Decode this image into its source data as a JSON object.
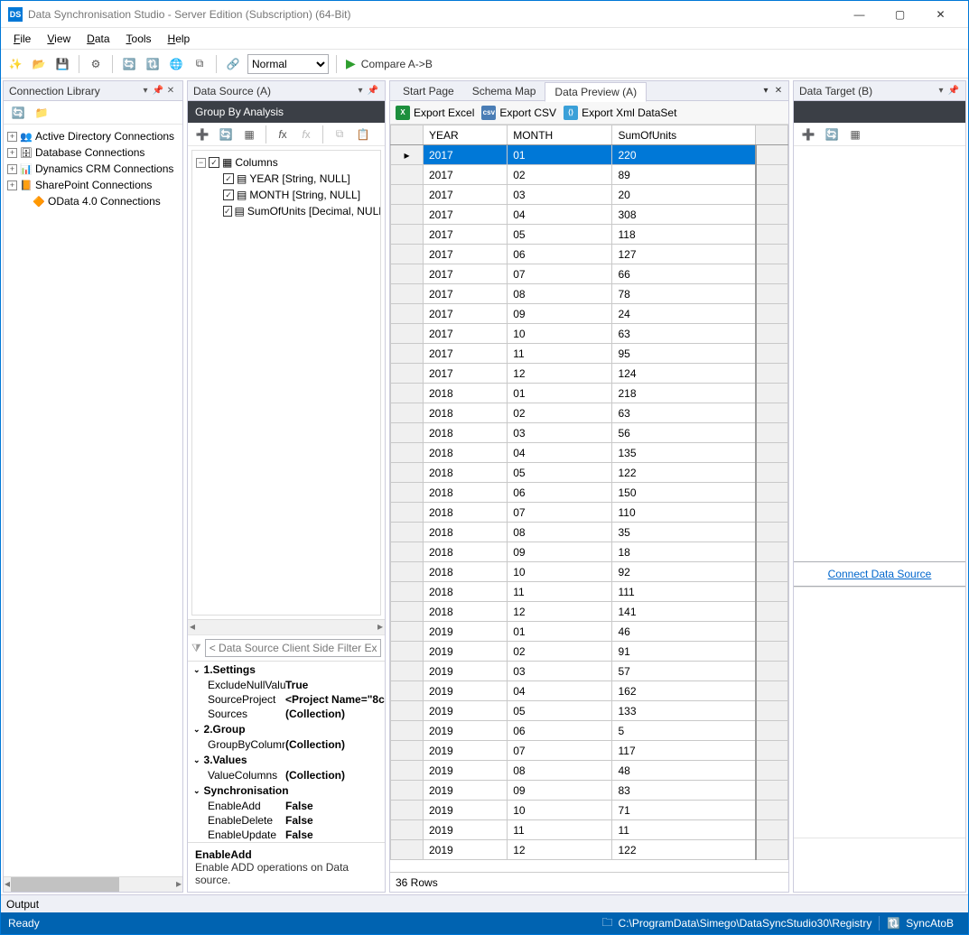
{
  "window": {
    "title": "Data Synchronisation Studio - Server Edition (Subscription) (64-Bit)"
  },
  "menu": {
    "items": [
      "File",
      "View",
      "Data",
      "Tools",
      "Help"
    ]
  },
  "toolbar": {
    "mode_value": "Normal",
    "compare_label": "Compare A->B"
  },
  "left": {
    "title": "Connection Library",
    "tree": [
      {
        "icon": "ad",
        "label": "Active Directory Connections",
        "expandable": true
      },
      {
        "icon": "db",
        "label": "Database Connections",
        "expandable": true
      },
      {
        "icon": "crm",
        "label": "Dynamics CRM Connections",
        "expandable": true
      },
      {
        "icon": "sp",
        "label": "SharePoint Connections",
        "expandable": true
      },
      {
        "icon": "odata",
        "label": "OData 4.0 Connections",
        "expandable": false,
        "indent": true
      }
    ]
  },
  "source": {
    "title": "Data Source (A)",
    "groupby_title": "Group By Analysis",
    "columns_label": "Columns",
    "columns": [
      "YEAR [String, NULL]",
      "MONTH [String, NULL]",
      "SumOfUnits [Decimal, NULL]"
    ],
    "filter_placeholder": "< Data Source Client Side Filter Expression >",
    "props": {
      "g1": "1.Settings",
      "p1k": "ExcludeNullValues",
      "p1v": "True",
      "p2k": "SourceProject",
      "p2v": "<Project Name=\"8c...",
      "p3k": "Sources",
      "p3v": "(Collection)",
      "g2": "2.Group",
      "p4k": "GroupByColumns",
      "p4v": "(Collection)",
      "g3": "3.Values",
      "p5k": "ValueColumns",
      "p5v": "(Collection)",
      "g4": "Synchronisation",
      "p6k": "EnableAdd",
      "p6v": "False",
      "p7k": "EnableDelete",
      "p7v": "False",
      "p8k": "EnableUpdate",
      "p8v": "False"
    },
    "help_title": "EnableAdd",
    "help_desc": "Enable ADD operations on Data source."
  },
  "center": {
    "tabs": [
      "Start Page",
      "Schema Map",
      "Data Preview (A)"
    ],
    "active_tab": 2,
    "export_excel": "Export Excel",
    "export_csv": "Export CSV",
    "export_xml": "Export Xml DataSet",
    "columns": [
      "YEAR",
      "MONTH",
      "SumOfUnits"
    ],
    "rows": [
      [
        "2017",
        "01",
        "220"
      ],
      [
        "2017",
        "02",
        "89"
      ],
      [
        "2017",
        "03",
        "20"
      ],
      [
        "2017",
        "04",
        "308"
      ],
      [
        "2017",
        "05",
        "118"
      ],
      [
        "2017",
        "06",
        "127"
      ],
      [
        "2017",
        "07",
        "66"
      ],
      [
        "2017",
        "08",
        "78"
      ],
      [
        "2017",
        "09",
        "24"
      ],
      [
        "2017",
        "10",
        "63"
      ],
      [
        "2017",
        "11",
        "95"
      ],
      [
        "2017",
        "12",
        "124"
      ],
      [
        "2018",
        "01",
        "218"
      ],
      [
        "2018",
        "02",
        "63"
      ],
      [
        "2018",
        "03",
        "56"
      ],
      [
        "2018",
        "04",
        "135"
      ],
      [
        "2018",
        "05",
        "122"
      ],
      [
        "2018",
        "06",
        "150"
      ],
      [
        "2018",
        "07",
        "110"
      ],
      [
        "2018",
        "08",
        "35"
      ],
      [
        "2018",
        "09",
        "18"
      ],
      [
        "2018",
        "10",
        "92"
      ],
      [
        "2018",
        "11",
        "111"
      ],
      [
        "2018",
        "12",
        "141"
      ],
      [
        "2019",
        "01",
        "46"
      ],
      [
        "2019",
        "02",
        "91"
      ],
      [
        "2019",
        "03",
        "57"
      ],
      [
        "2019",
        "04",
        "162"
      ],
      [
        "2019",
        "05",
        "133"
      ],
      [
        "2019",
        "06",
        "5"
      ],
      [
        "2019",
        "07",
        "117"
      ],
      [
        "2019",
        "08",
        "48"
      ],
      [
        "2019",
        "09",
        "83"
      ],
      [
        "2019",
        "10",
        "71"
      ],
      [
        "2019",
        "11",
        "11"
      ],
      [
        "2019",
        "12",
        "122"
      ]
    ],
    "footer": "36 Rows"
  },
  "right": {
    "title": "Data Target (B)",
    "connect_label": "Connect Data Source"
  },
  "output_label": "Output",
  "status": {
    "ready": "Ready",
    "path": "C:\\ProgramData\\Simego\\DataSyncStudio30\\Registry",
    "sync": "SyncAtoB"
  }
}
